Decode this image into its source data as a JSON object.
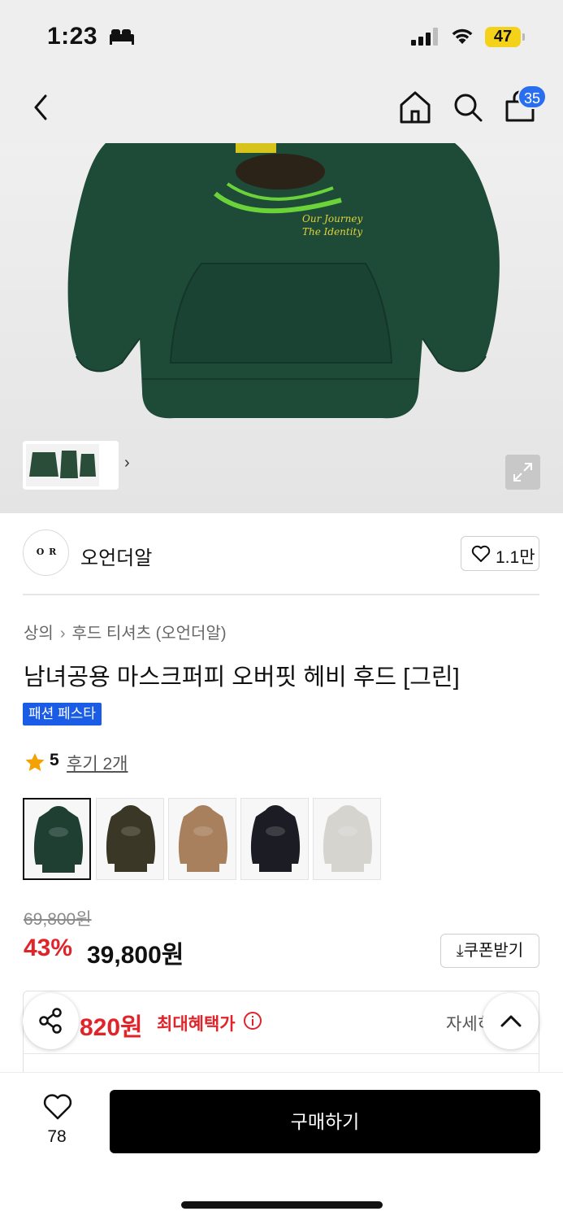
{
  "status_bar": {
    "time": "1:23",
    "battery": "47"
  },
  "nav": {
    "cart_count": "35"
  },
  "brand": {
    "logo_text": "O R",
    "name": "오언더알",
    "like_count": "1.1만"
  },
  "product": {
    "breadcrumb": [
      "상의",
      "후드 티셔츠 (오언더알)"
    ],
    "title": "남녀공용 마스크퍼피 오버핏 헤비 후드 [그린]",
    "event_badge": "패션 페스타",
    "rating": "5",
    "review_link": "후기 2개",
    "hero_print_text": [
      "Our Journey",
      "The Identity"
    ]
  },
  "swatches": [
    {
      "color": "#1f3f33",
      "selected": true
    },
    {
      "color": "#3b3726",
      "selected": false
    },
    {
      "color": "#a8805e",
      "selected": false
    },
    {
      "color": "#1c1c24",
      "selected": false
    },
    {
      "color": "#d6d4cf",
      "selected": false
    }
  ],
  "price": {
    "original": "69,800원",
    "discount": "43%",
    "sale": "39,800원",
    "coupon_label": "쿠폰받기"
  },
  "benefit": {
    "max_price": "820원",
    "max_label": "최대혜택가",
    "detail_link": "자세히"
  },
  "bottom_bar": {
    "wish_count": "78",
    "buy_label": "구매하기"
  },
  "colors": {
    "accent_red": "#e0242a",
    "badge_blue": "#1b5ce6",
    "cart_badge": "#2a6ef0"
  }
}
